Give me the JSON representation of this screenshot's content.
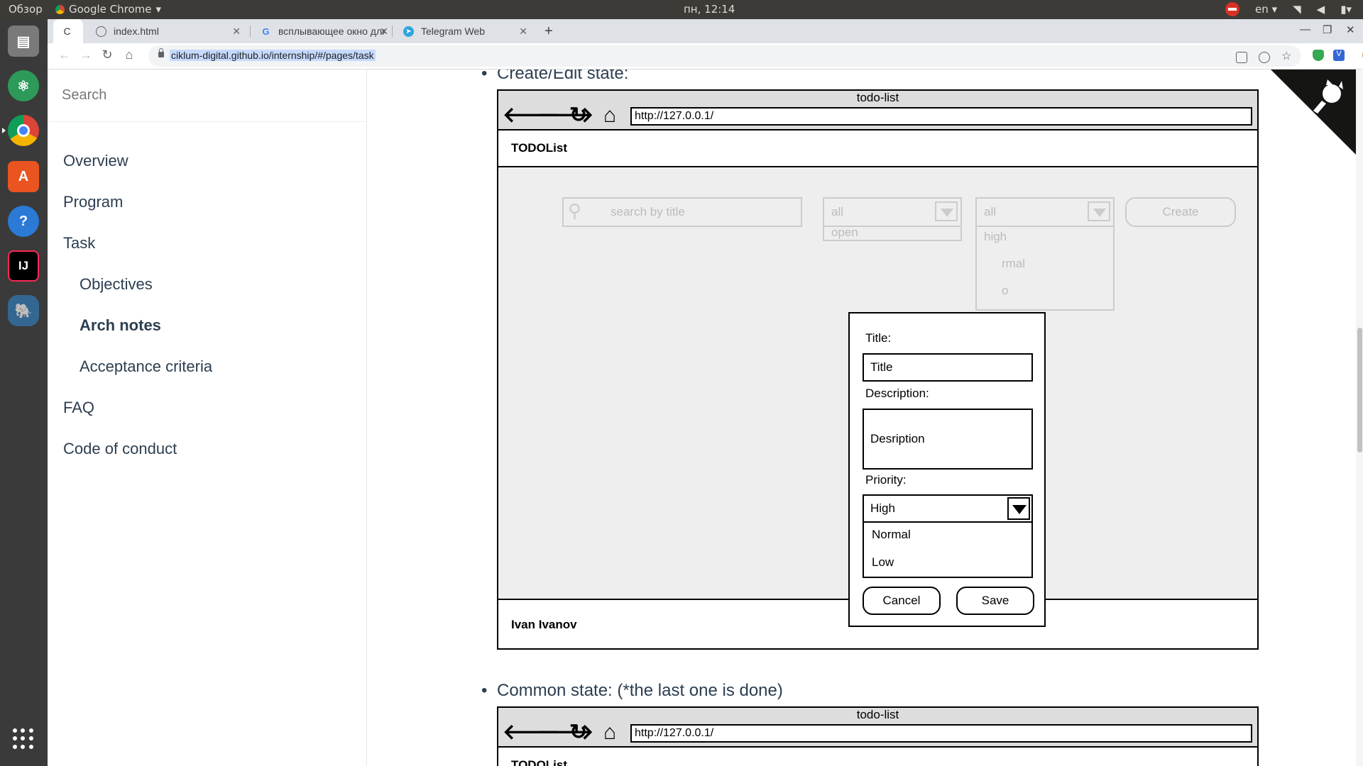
{
  "topbar": {
    "overview": "Обзор",
    "app_name": "Google Chrome",
    "clock": "пн, 12:14",
    "lang": "en"
  },
  "tabs": [
    {
      "title": "index.html"
    },
    {
      "title": "всплывающее окно для"
    },
    {
      "title": "Telegram Web"
    }
  ],
  "toolbar": {
    "url": "ciklum-digital.github.io/internship/#/pages/task"
  },
  "sidebar": {
    "search_placeholder": "Search",
    "items": [
      {
        "label": "Overview"
      },
      {
        "label": "Program"
      },
      {
        "label": "Task"
      },
      {
        "label": "Objectives"
      },
      {
        "label": "Arch notes"
      },
      {
        "label": "Acceptance criteria"
      },
      {
        "label": "FAQ"
      },
      {
        "label": "Code of conduct"
      }
    ]
  },
  "content": {
    "section1": "Create/Edit state:",
    "section2": "Common state: (*the last one is done)",
    "mockup": {
      "window_title": "todo-list",
      "url": "http://127.0.0.1/",
      "app_title": "TODOList",
      "search_placeholder": "search by title",
      "filter1_value": "all",
      "filter1_option": "open",
      "filter2_value": "all",
      "filter2_options": [
        "high",
        "rmal",
        "o"
      ],
      "create_label": "Create",
      "footer_user": "Ivan Ivanov",
      "modal": {
        "title_label": "Title:",
        "title_value": "Title",
        "desc_label": "Description:",
        "desc_value": "Desription",
        "priority_label": "Priority:",
        "priority_selected": "High",
        "priority_options": [
          "Normal",
          "Low"
        ],
        "cancel": "Cancel",
        "save": "Save"
      }
    },
    "mockup2": {
      "window_title": "todo-list",
      "url": "http://127.0.0.1/",
      "app_title": "TODOList"
    }
  }
}
